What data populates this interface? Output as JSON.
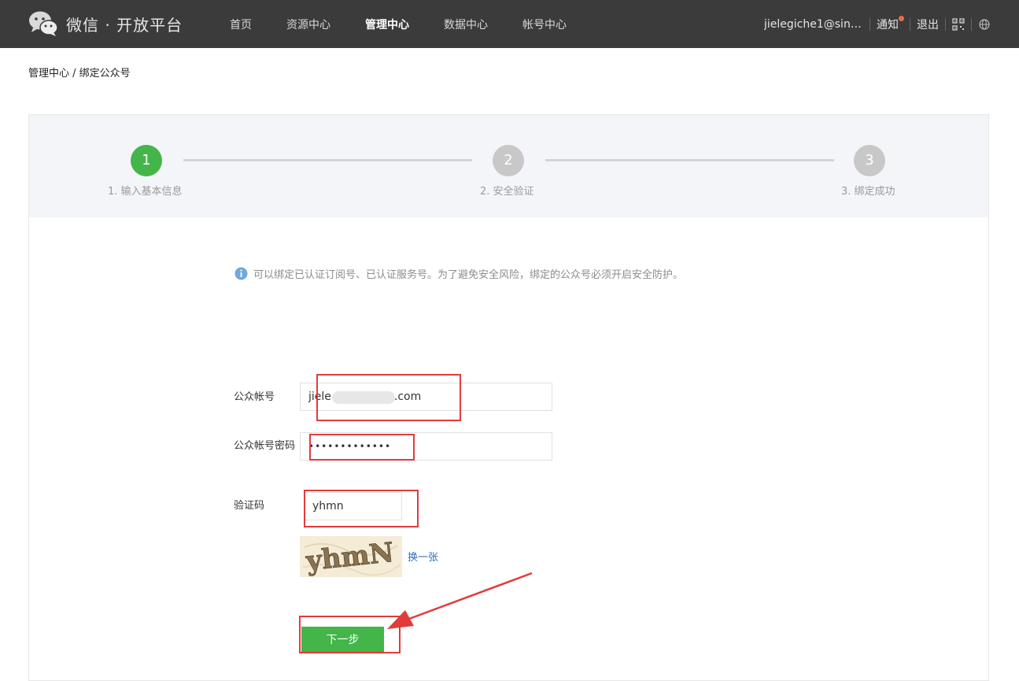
{
  "header": {
    "brand_name": "微信 · 开放平台",
    "nav": [
      "首页",
      "资源中心",
      "管理中心",
      "数据中心",
      "帐号中心"
    ],
    "active_nav": "管理中心",
    "user": "jielegiche1@sina...",
    "notify_label": "通知",
    "logout_label": "退出",
    "qr_icon": "qr-code-icon",
    "globe_icon": "globe-icon"
  },
  "breadcrumb": "管理中心 / 绑定公众号",
  "steps": [
    {
      "number": "1",
      "label": "1. 输入基本信息",
      "state": "active"
    },
    {
      "number": "2",
      "label": "2. 安全验证",
      "state": "pending"
    },
    {
      "number": "3",
      "label": "3. 绑定成功",
      "state": "pending"
    }
  ],
  "notice": "可以绑定已认证订阅号、已认证服务号。为了避免安全风险，绑定的公众号必须开启安全防护。",
  "form": {
    "account_label": "公众帐号",
    "account_value_prefix": "jiele",
    "account_value_suffix": ".com",
    "password_label": "公众帐号密码",
    "password_value": "•••••••••••••",
    "captcha_label": "验证码",
    "captcha_value": "yhmn",
    "captcha_image_text": "yhmN",
    "change_captcha": "换一张",
    "next_button": "下一步"
  },
  "colors": {
    "topbar": "#3b3b3b",
    "accent_green": "#43b549",
    "highlight_red": "#e23b3b",
    "link_blue": "#2a6ebd"
  }
}
